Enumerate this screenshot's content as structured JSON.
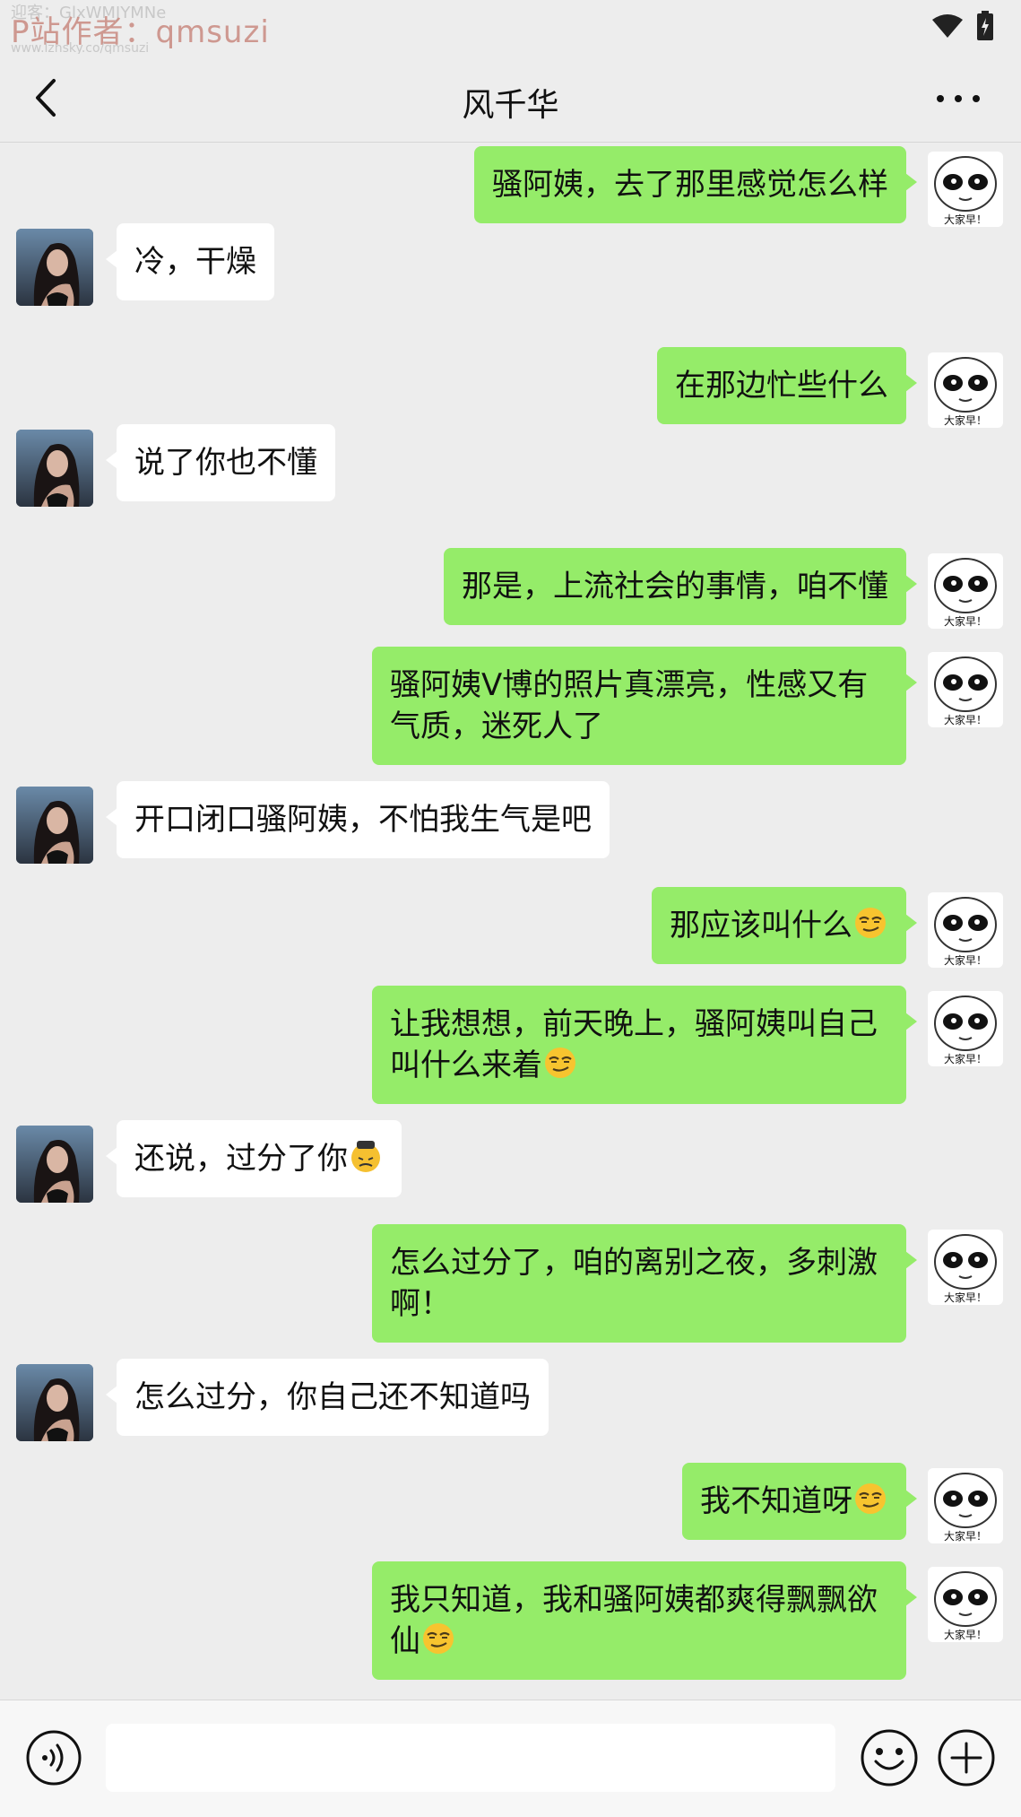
{
  "watermark": {
    "top_text": "迎客：GlxWMJYMNe",
    "main_text": "P站作者：qmsuzi",
    "sub_text": "www.lznsky.co/qmsuzi"
  },
  "header": {
    "title": "风千华"
  },
  "me": {
    "avatar_caption": "大家早！"
  },
  "messages": [
    {
      "side": "right",
      "text": "骚阿姨，去了那里感觉怎么样"
    },
    {
      "side": "left",
      "text": "冷，干燥"
    },
    {
      "side": "right",
      "text": "在那边忙些什么"
    },
    {
      "side": "left",
      "text": "说了你也不懂"
    },
    {
      "side": "right",
      "text": "那是，上流社会的事情，咱不懂"
    },
    {
      "side": "right",
      "text": "骚阿姨V博的照片真漂亮，性感又有气质，迷死人了"
    },
    {
      "side": "left",
      "text": "开口闭口骚阿姨，不怕我生气是吧"
    },
    {
      "side": "right",
      "text": "那应该叫什么",
      "emoji": "smirk-emoji"
    },
    {
      "side": "right",
      "text": "让我想想，前天晚上，骚阿姨叫自己叫什么来着",
      "emoji": "smirk-emoji"
    },
    {
      "side": "left",
      "text": "还说，过分了你",
      "emoji": "angry-emoji"
    },
    {
      "side": "right",
      "text": "怎么过分了，咱的离别之夜，多刺激啊！"
    },
    {
      "side": "left",
      "text": "怎么过分，你自己还不知道吗"
    },
    {
      "side": "right",
      "text": "我不知道呀",
      "emoji": "smirk-emoji"
    },
    {
      "side": "right",
      "text": "我只知道，我和骚阿姨都爽得飘飘欲仙",
      "emoji": "smirk-emoji"
    }
  ],
  "input": {
    "placeholder": "",
    "value": ""
  },
  "colors": {
    "my_bubble": "#95ec69",
    "their_bubble": "#ffffff",
    "background": "#ededed"
  }
}
